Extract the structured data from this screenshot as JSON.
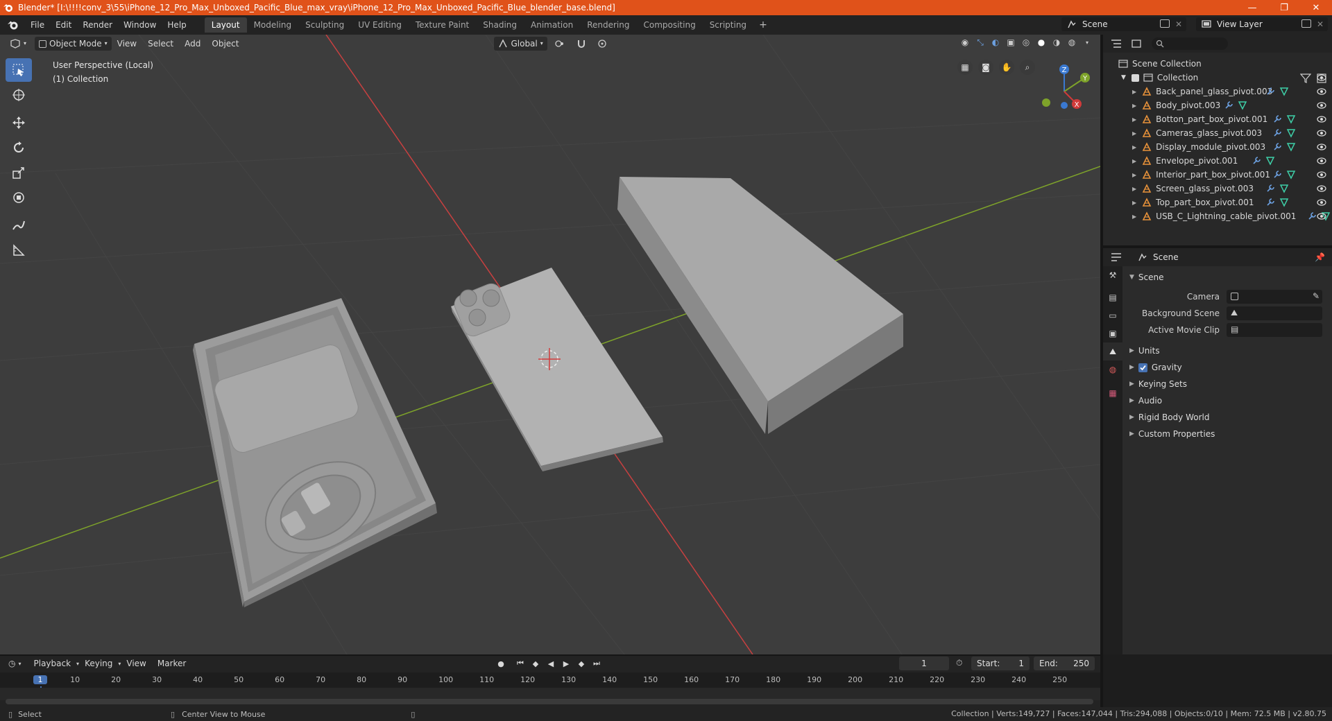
{
  "window": {
    "title": "Blender* [I:\\!!!!conv_3\\55\\iPhone_12_Pro_Max_Unboxed_Pacific_Blue_max_vray\\iPhone_12_Pro_Max_Unboxed_Pacific_Blue_blender_base.blend]",
    "minimize": "—",
    "maximize": "❐",
    "close": "✕"
  },
  "menu": [
    "File",
    "Edit",
    "Render",
    "Window",
    "Help"
  ],
  "workspaces": [
    "Layout",
    "Modeling",
    "Sculpting",
    "UV Editing",
    "Texture Paint",
    "Shading",
    "Animation",
    "Rendering",
    "Compositing",
    "Scripting"
  ],
  "workspace_add": "+",
  "scene_field": "Scene",
  "view_layer_field": "View Layer",
  "viewport": {
    "mode": "Object Mode",
    "menus": [
      "View",
      "Select",
      "Add",
      "Object"
    ],
    "orientation": "Global",
    "perspective_label": "User Perspective (Local)",
    "collection_label": "(1) Collection",
    "gizmo": {
      "x": "X",
      "y": "Y",
      "z": "Z"
    }
  },
  "outliner": {
    "root": "Scene Collection",
    "collection": "Collection",
    "objects": [
      "Back_panel_glass_pivot.003",
      "Body_pivot.003",
      "Botton_part_box_pivot.001",
      "Cameras_glass_pivot.003",
      "Display_module_pivot.003",
      "Envelope_pivot.001",
      "Interior_part_box_pivot.001",
      "Screen_glass_pivot.003",
      "Top_part_box_pivot.001",
      "USB_C_Lightning_cable_pivot.001"
    ]
  },
  "properties": {
    "header": "Scene",
    "section": "Scene",
    "fields": [
      {
        "label": "Camera"
      },
      {
        "label": "Background Scene"
      },
      {
        "label": "Active Movie Clip"
      }
    ],
    "panels": [
      "Units",
      "Gravity",
      "Keying Sets",
      "Audio",
      "Rigid Body World",
      "Custom Properties"
    ]
  },
  "timeline": {
    "menus": [
      "Playback",
      "Keying",
      "View",
      "Marker"
    ],
    "current_frame": "1",
    "start_label": "Start:",
    "start": "1",
    "end_label": "End:",
    "end": "250",
    "ticks": [
      "1",
      "10",
      "20",
      "30",
      "40",
      "50",
      "60",
      "70",
      "80",
      "90",
      "100",
      "110",
      "120",
      "130",
      "140",
      "150",
      "160",
      "170",
      "180",
      "190",
      "200",
      "210",
      "220",
      "230",
      "240",
      "250"
    ]
  },
  "status": {
    "left": "Select",
    "middle": "Center View to Mouse",
    "right": "Collection | Verts:149,727 | Faces:147,044 | Tris:294,088 | Objects:0/10 | Mem: 72.5 MB | v2.80.75"
  },
  "colors": {
    "title_bar": "#e0521a",
    "accent": "#4772b3",
    "viewport_bg": "#3d3d3d",
    "axis_x": "#d13a3a",
    "axis_y": "#7ea32a",
    "axis_z": "#3a79d1"
  }
}
